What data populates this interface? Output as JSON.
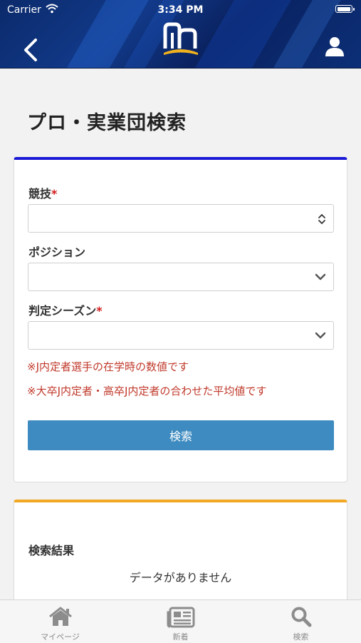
{
  "statusbar": {
    "carrier": "Carrier",
    "time": "3:34 PM",
    "battery_level": 1.0
  },
  "header": {
    "back_icon": "chevron-left-icon",
    "logo": "brand-logo",
    "user_icon": "user-icon"
  },
  "page": {
    "title": "プロ・実業団検索"
  },
  "form": {
    "sport": {
      "label": "競技",
      "required_mark": "*",
      "value": ""
    },
    "position": {
      "label": "ポジション",
      "value": ""
    },
    "season": {
      "label": "判定シーズン",
      "required_mark": "*",
      "value": ""
    },
    "notes": [
      "※J内定者選手の在学時の数値です",
      "※大卒J内定者・高卒J内定者の合わせた平均値です"
    ],
    "search_label": "検索"
  },
  "results": {
    "title": "検索結果",
    "empty_text": "データがありません"
  },
  "tabbar": {
    "items": [
      {
        "label": "マイページ",
        "icon": "home-icon"
      },
      {
        "label": "新着",
        "icon": "newspaper-icon"
      },
      {
        "label": "検索",
        "icon": "search-icon"
      }
    ]
  },
  "colors": {
    "header_bg": "#0b2a6b",
    "form_accent": "#1a1ad6",
    "results_accent": "#f2a825",
    "button": "#3d8bc0",
    "note_text": "#c0392b",
    "required": "#d21a1a"
  }
}
